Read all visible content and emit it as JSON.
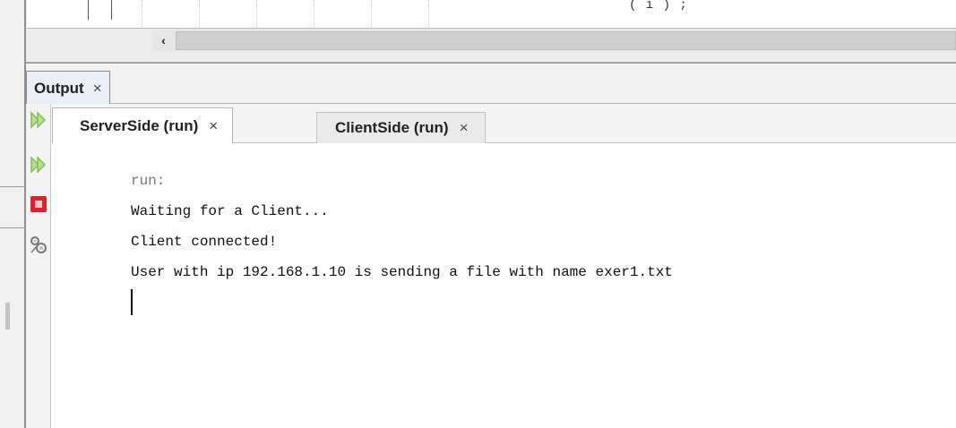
{
  "editor": {
    "code_fragment": "( i ) ;",
    "scroll_left_glyph": "‹"
  },
  "output": {
    "title": "Output",
    "close_glyph": "×"
  },
  "toolbar": {
    "icons": [
      "rerun-icon",
      "rerun-with-options-icon",
      "stop-icon",
      "settings-icon"
    ],
    "run_color": "#7fbf4d",
    "stop_color": "#e0202a"
  },
  "tabs": [
    {
      "label": "ServerSide (run)",
      "close": "×",
      "active": true
    },
    {
      "label": "ClientSide (run)",
      "close": "×",
      "active": false
    }
  ],
  "console": {
    "lines": [
      "run:",
      "Waiting for a Client...",
      "Client connected!",
      "User with ip 192.168.1.10 is sending a file with name exer1.txt"
    ]
  }
}
